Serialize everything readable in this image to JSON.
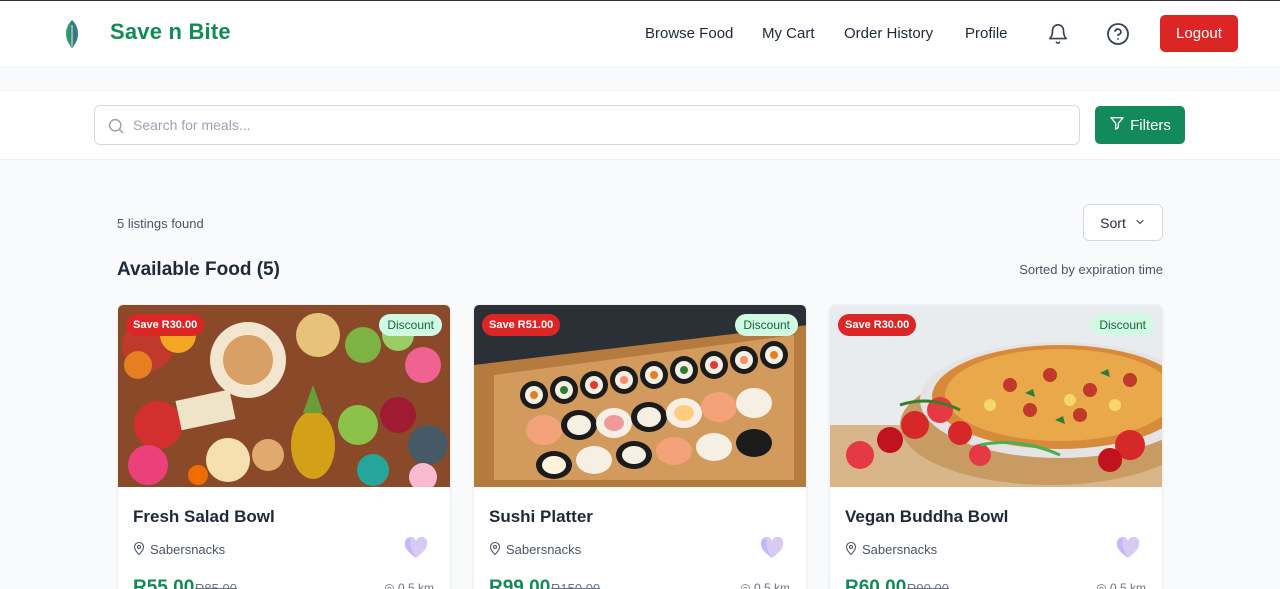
{
  "header": {
    "brand": "Save n Bite",
    "nav": [
      "Browse Food",
      "My Cart",
      "Order History",
      "Profile"
    ],
    "logout_label": "Logout"
  },
  "search": {
    "placeholder": "Search for meals...",
    "filters_label": "Filters"
  },
  "listing": {
    "count_text": "5 listings found",
    "sort_label": "Sort",
    "section_title": "Available Food (5)",
    "sorted_by": "Sorted by expiration time"
  },
  "cards": [
    {
      "title": "Fresh Salad Bowl",
      "vendor": "Sabersnacks",
      "price": "R55.00",
      "old_price": "R85.00",
      "save_badge": "Save R30.00",
      "discount_badge": "Discount",
      "distance": "0.5 km"
    },
    {
      "title": "Sushi Platter",
      "vendor": "Sabersnacks",
      "price": "R99.00",
      "old_price": "R150.00",
      "save_badge": "Save R51.00",
      "discount_badge": "Discount",
      "distance": "0.5 km"
    },
    {
      "title": "Vegan Buddha Bowl",
      "vendor": "Sabersnacks",
      "price": "R60.00",
      "old_price": "R90.00",
      "save_badge": "Save R30.00",
      "discount_badge": "Discount",
      "distance": "0.5 km"
    }
  ],
  "colors": {
    "brand_green": "#138a5a",
    "danger_red": "#dc2626",
    "discount_bg": "#d1fae5",
    "heart_purple": "#c4b5fd"
  },
  "icons": [
    "leaf-logo-icon",
    "bell-icon",
    "help-circle-icon",
    "search-icon",
    "filter-icon",
    "chevron-down-icon",
    "map-pin-icon",
    "heart-icon",
    "location-dot-icon"
  ]
}
